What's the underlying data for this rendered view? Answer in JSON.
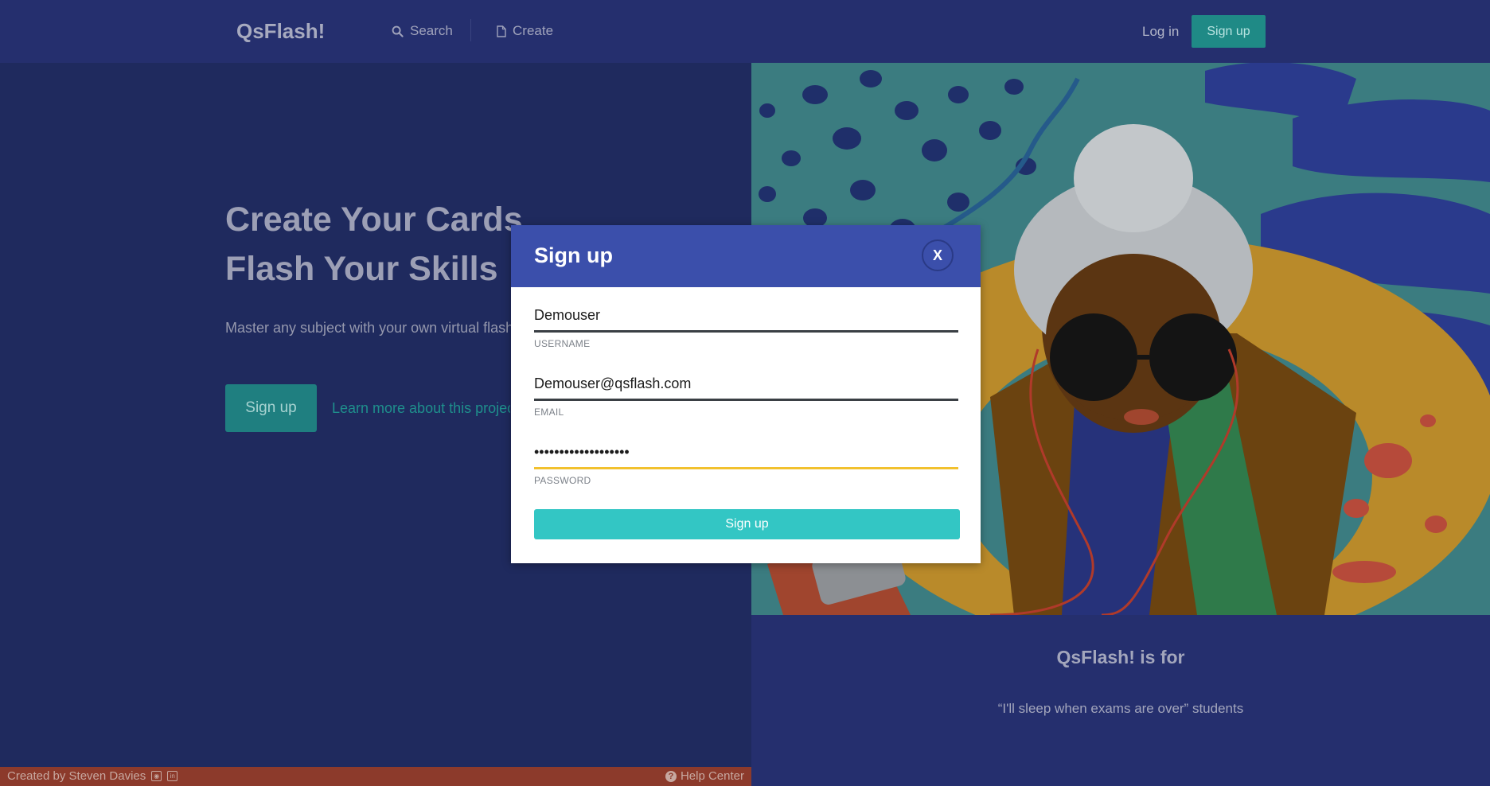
{
  "nav": {
    "brand": "QsFlash!",
    "search_label": "Search",
    "create_label": "Create",
    "login_label": "Log in",
    "signup_label": "Sign up"
  },
  "hero": {
    "title_line1": "Create Your Cards",
    "title_line2": "Flash Your Skills",
    "subtitle": "Master any subject with your own virtual flashcards",
    "signup_label": "Sign up",
    "learn_more_label": "Learn more about this project"
  },
  "audience": {
    "title": "QsFlash! is for",
    "quote": "“I'll sleep when exams are over” students"
  },
  "footer": {
    "credit": "Created by Steven Davies",
    "help_label": "Help Center"
  },
  "modal": {
    "title": "Sign up",
    "close_label": "X",
    "username_value": "Demouser",
    "username_label": "USERNAME",
    "email_value": "Demouser@qsflash.com",
    "email_label": "EMAIL",
    "password_value": "passwordpassword123",
    "password_label": "PASSWORD",
    "submit_label": "Sign up"
  },
  "colors": {
    "nav_bg": "#252f6e",
    "page_bg": "#1f2a5e",
    "accent_teal": "#33c6c4",
    "modal_header": "#3b4fab",
    "focus_yellow": "#f2c12e",
    "footer_red": "#8c3a2b"
  },
  "icons": [
    "search-icon",
    "document-icon",
    "github-icon",
    "linkedin-icon",
    "help-icon",
    "close-icon"
  ]
}
